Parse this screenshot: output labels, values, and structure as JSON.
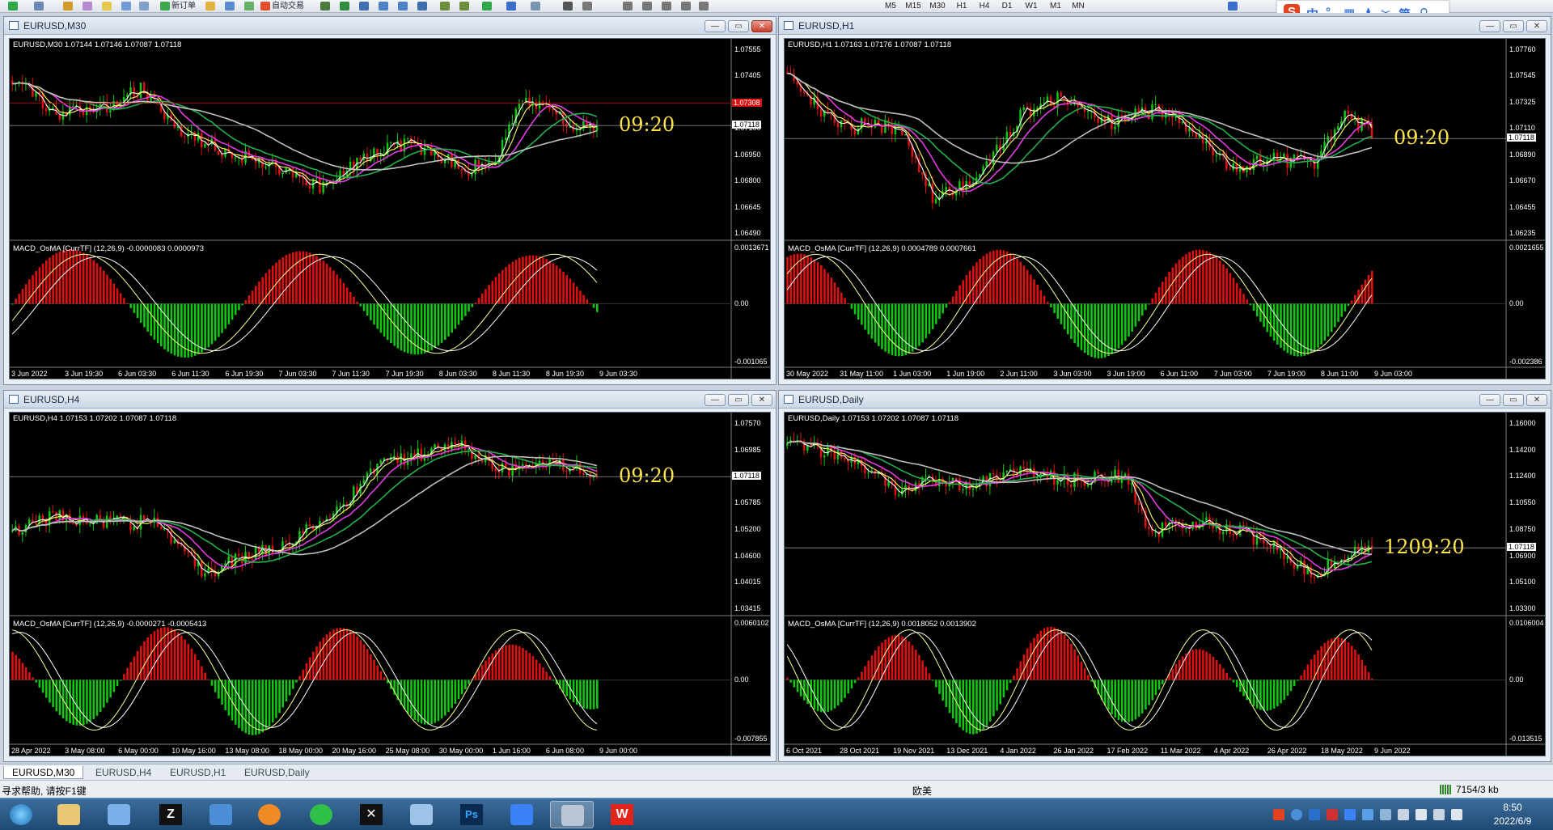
{
  "toolbar": {
    "new_order_label": "新订单",
    "auto_trade_label": "自动交易",
    "timeframes": [
      "M5",
      "M15",
      "M30",
      "H1",
      "H4",
      "D1",
      "W1",
      "M1",
      "MN"
    ]
  },
  "ime": {
    "logo": "S",
    "lang": "中",
    "simplified": "简"
  },
  "windows": [
    {
      "title": "EURUSD,M30",
      "header": "EURUSD,M30  1.07144 1.07146 1.07087 1.07118",
      "macd_header": "MACD_OsMA [CurrTF] (12,26,9) -0.0000083 0.0000973",
      "timer": "09:20",
      "current_price": "1.07118",
      "red_tag": "1.07308",
      "price_axis": [
        "1.07555",
        "1.07405",
        "1.07250",
        "1.07100",
        "1.06950",
        "1.06800",
        "1.06645",
        "1.06490"
      ],
      "macd_axis": [
        "0.0013671",
        "0.00",
        "-0.001065"
      ],
      "time_axis": [
        "3 Jun 2022",
        "3 Jun 19:30",
        "6 Jun 03:30",
        "6 Jun 11:30",
        "6 Jun 19:30",
        "7 Jun 03:30",
        "7 Jun 11:30",
        "7 Jun 19:30",
        "8 Jun 03:30",
        "8 Jun 11:30",
        "8 Jun 19:30",
        "9 Jun 03:30"
      ]
    },
    {
      "title": "EURUSD,H1",
      "header": "EURUSD,H1  1.07163 1.07176 1.07087 1.07118",
      "macd_header": "MACD_OsMA [CurrTF] (12,26,9) 0.0004789 0.0007661",
      "timer": "09:20",
      "current_price": "1.07118",
      "price_axis": [
        "1.07760",
        "1.07545",
        "1.07325",
        "1.07110",
        "1.06890",
        "1.06670",
        "1.06455",
        "1.06235"
      ],
      "macd_axis": [
        "0.0021655",
        "0.00",
        "-0.002386"
      ],
      "time_axis": [
        "30 May 2022",
        "31 May 11:00",
        "1 Jun 03:00",
        "1 Jun 19:00",
        "2 Jun 11:00",
        "3 Jun 03:00",
        "3 Jun 19:00",
        "6 Jun 11:00",
        "7 Jun 03:00",
        "7 Jun 19:00",
        "8 Jun 11:00",
        "9 Jun 03:00"
      ]
    },
    {
      "title": "EURUSD,H4",
      "header": "EURUSD,H4  1.07153 1.07202 1.07087 1.07118",
      "macd_header": "MACD_OsMA [CurrTF] (12,26,9) -0.0000271 -0.0005413",
      "timer": "09:20",
      "current_price": "1.07118",
      "price_axis": [
        "1.07570",
        "1.06985",
        "1.06385",
        "1.05785",
        "1.05200",
        "1.04600",
        "1.04015",
        "1.03415"
      ],
      "macd_axis": [
        "0.0060102",
        "0.00",
        "-0.007855"
      ],
      "time_axis": [
        "28 Apr 2022",
        "3 May 08:00",
        "6 May 00:00",
        "10 May 16:00",
        "13 May 08:00",
        "18 May 00:00",
        "20 May 16:00",
        "25 May 08:00",
        "30 May 00:00",
        "1 Jun 16:00",
        "6 Jun 08:00",
        "9 Jun 00:00"
      ]
    },
    {
      "title": "EURUSD,Daily",
      "header": "EURUSD,Daily  1.07153 1.07202 1.07087 1.07118",
      "macd_header": "MACD_OsMA [CurrTF] (12,26,9) 0.0018052 0.0013902",
      "timer": "1209:20",
      "current_price": "1.07118",
      "price_axis": [
        "1.16000",
        "1.14200",
        "1.12400",
        "1.10550",
        "1.08750",
        "1.06900",
        "1.05100",
        "1.03300"
      ],
      "macd_axis": [
        "0.0106004",
        "0.00",
        "-0.013515"
      ],
      "time_axis": [
        "6 Oct 2021",
        "28 Oct 2021",
        "19 Nov 2021",
        "13 Dec 2021",
        "4 Jan 2022",
        "26 Jan 2022",
        "17 Feb 2022",
        "11 Mar 2022",
        "4 Apr 2022",
        "26 Apr 2022",
        "18 May 2022",
        "9 Jun 2022"
      ]
    }
  ],
  "tabs": [
    "EURUSD,M30",
    "EURUSD,H4",
    "EURUSD,H1",
    "EURUSD,Daily"
  ],
  "status": {
    "help": "寻求帮助, 请按F1键",
    "profile": "欧美",
    "traffic": "7154/3 kb"
  },
  "taskbar": {
    "time": "8:50",
    "date": "2022/6/9"
  },
  "colors": {
    "bull": "#12c612",
    "bear": "#e01010",
    "ma_white": "#ffffff",
    "ma_yellow": "#ffff66",
    "ma_magenta": "#e23ce2",
    "ma_green": "#22b14c",
    "ma_gray": "#bfbfbf",
    "timer": "#ffe54a"
  }
}
